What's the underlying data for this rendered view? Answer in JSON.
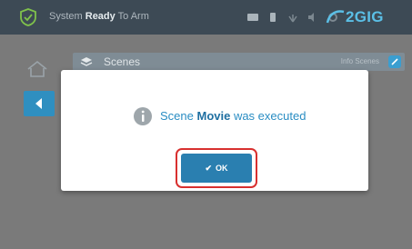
{
  "status_bar": {
    "system_prefix": "System",
    "system_state": "Ready",
    "system_suffix": "To Arm",
    "brand": "2GIG",
    "icons": [
      "message-icon",
      "phone-icon",
      "signal-icon",
      "volume-icon",
      "settings-icon"
    ]
  },
  "scenes": {
    "title": "Scenes",
    "info_text": "Info Scenes"
  },
  "dialog": {
    "message_before": "Scene ",
    "scene_name": "Movie",
    "message_after": " was executed",
    "ok_label": "OK"
  },
  "colors": {
    "accent": "#2a7fb0",
    "brand": "#5bbfe6",
    "highlight_border": "#d8302f"
  }
}
